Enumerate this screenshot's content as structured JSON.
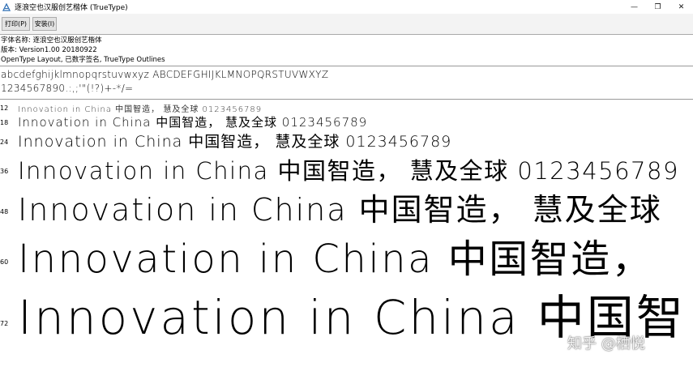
{
  "window": {
    "title": "逐浪空也汉服创艺楷体 (TrueType)",
    "app_icon": "font-viewer-icon",
    "controls": {
      "minimize": "—",
      "maximize": "❐",
      "close": "✕"
    }
  },
  "toolbar": {
    "print_label": "打印(P)",
    "install_label": "安装(I)"
  },
  "info": {
    "font_name": "字体名称: 逐浪空也汉服创艺楷体",
    "version": "版本: Version1.00 20180922",
    "features": "OpenType Layout, 已数字签名, TrueType Outlines"
  },
  "charset": {
    "line1": "abcdefghijklmnopqrstuvwxyz ABCDEFGHIJKLMNOPQRSTUVWXYZ",
    "line2": "1234567890.:,;'\"(!?)+-*/="
  },
  "samples": [
    {
      "size": "12",
      "text": "Innovation in China 中国智造， 慧及全球 0123456789"
    },
    {
      "size": "18",
      "text": "Innovation in China 中国智造， 慧及全球 0123456789"
    },
    {
      "size": "24",
      "text": "Innovation in China 中国智造， 慧及全球 0123456789"
    },
    {
      "size": "36",
      "text": "Innovation in China 中国智造， 慧及全球 0123456789"
    },
    {
      "size": "48",
      "text": "Innovation in China 中国智造， 慧及全球"
    },
    {
      "size": "60",
      "text": "Innovation in China 中国智造，"
    },
    {
      "size": "72",
      "text": "Innovation in China 中国智"
    }
  ],
  "watermark": "知乎 @栖悦"
}
